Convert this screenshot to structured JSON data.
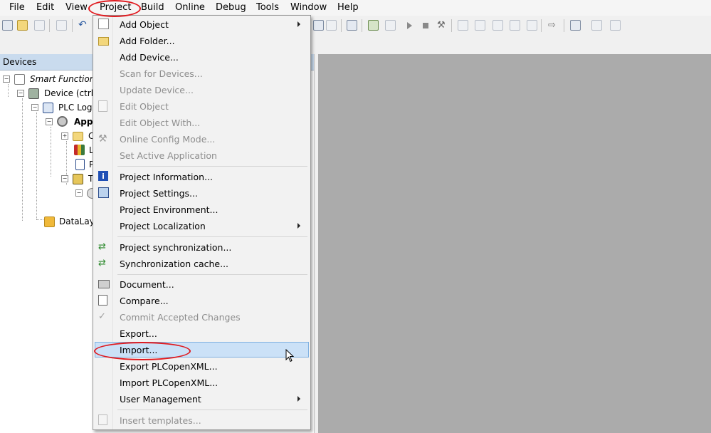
{
  "menubar": [
    "File",
    "Edit",
    "View",
    "Project",
    "Build",
    "Online",
    "Debug",
    "Tools",
    "Window",
    "Help"
  ],
  "devices_panel": {
    "title": "Devices",
    "tree": [
      {
        "label": "Smart Function Ki"
      },
      {
        "label": "Device (ctrlX"
      },
      {
        "label": "PLC Logic"
      },
      {
        "label": "Appl"
      },
      {
        "label": "C"
      },
      {
        "label": "L"
      },
      {
        "label": "P"
      },
      {
        "label": "T"
      },
      {
        "label": ""
      },
      {
        "label": "DataLaye"
      }
    ]
  },
  "project_menu": {
    "items": [
      {
        "label": "Add Object",
        "icon": "add-object-icon",
        "disabled": false,
        "submenu": true
      },
      {
        "label": "Add Folder...",
        "icon": "folder-icon",
        "disabled": false,
        "submenu": false
      },
      {
        "label": "Add Device...",
        "icon": "",
        "disabled": false,
        "submenu": false
      },
      {
        "label": "Scan for Devices...",
        "icon": "",
        "disabled": true,
        "submenu": false
      },
      {
        "label": "Update Device...",
        "icon": "",
        "disabled": true,
        "submenu": false
      },
      {
        "label": "Edit Object",
        "icon": "edit-object-icon",
        "disabled": true,
        "submenu": false
      },
      {
        "label": "Edit Object With...",
        "icon": "",
        "disabled": true,
        "submenu": false
      },
      {
        "label": "Online Config Mode...",
        "icon": "wrench-icon",
        "disabled": true,
        "submenu": false
      },
      {
        "label": "Set Active Application",
        "icon": "",
        "disabled": true,
        "submenu": false
      },
      {
        "label": "Project Information...",
        "icon": "info-icon",
        "disabled": false,
        "submenu": false
      },
      {
        "label": "Project Settings...",
        "icon": "settings-icon",
        "disabled": false,
        "submenu": false
      },
      {
        "label": "Project Environment...",
        "icon": "",
        "disabled": false,
        "submenu": false
      },
      {
        "label": "Project Localization",
        "icon": "",
        "disabled": false,
        "submenu": true
      },
      {
        "label": "Project synchronization...",
        "icon": "sync-icon",
        "disabled": false,
        "submenu": false
      },
      {
        "label": "Synchronization cache...",
        "icon": "sync-cache-icon",
        "disabled": false,
        "submenu": false
      },
      {
        "label": "Document...",
        "icon": "printer-icon",
        "disabled": false,
        "submenu": false
      },
      {
        "label": "Compare...",
        "icon": "compare-icon",
        "disabled": false,
        "submenu": false
      },
      {
        "label": "Commit Accepted Changes",
        "icon": "commit-icon",
        "disabled": true,
        "submenu": false
      },
      {
        "label": "Export...",
        "icon": "",
        "disabled": false,
        "submenu": false
      },
      {
        "label": "Import...",
        "icon": "",
        "disabled": false,
        "submenu": false,
        "highlighted": true
      },
      {
        "label": "Export PLCopenXML...",
        "icon": "",
        "disabled": false,
        "submenu": false
      },
      {
        "label": "Import PLCopenXML...",
        "icon": "",
        "disabled": false,
        "submenu": false
      },
      {
        "label": "User Management",
        "icon": "",
        "disabled": false,
        "submenu": true
      },
      {
        "label": "Insert templates...",
        "icon": "template-icon",
        "disabled": true,
        "submenu": false
      }
    ]
  },
  "colors": {
    "highlight": "#cbe1f7",
    "callout": "#e0191e",
    "editor_bg": "#ababab"
  }
}
